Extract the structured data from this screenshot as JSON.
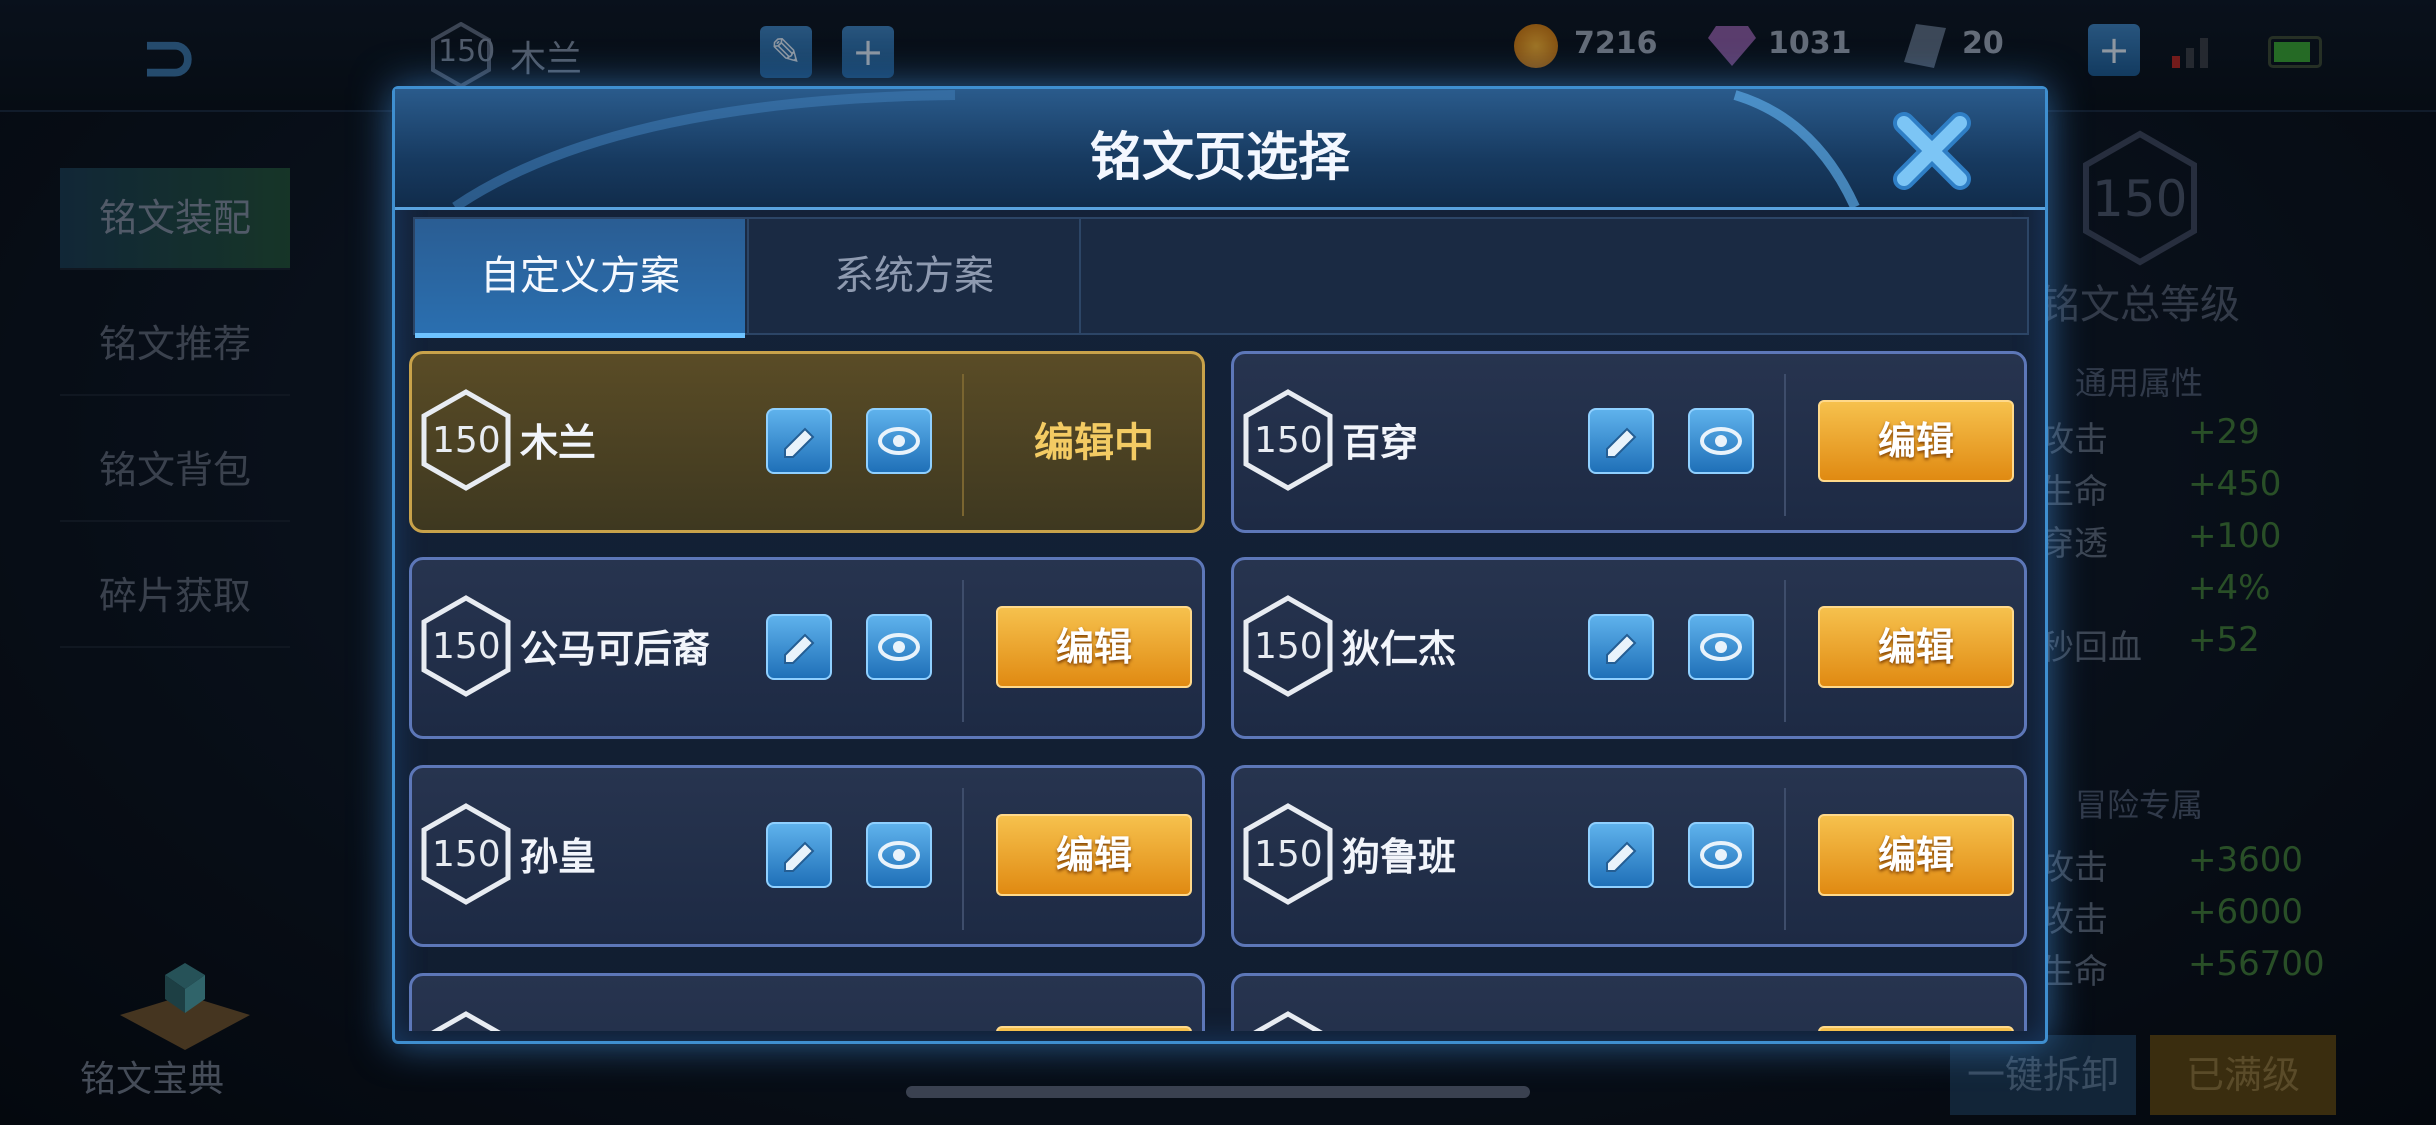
{
  "background": {
    "header": {
      "scheme_level": "150",
      "scheme_name": "木兰",
      "resources": [
        {
          "icon": "gold-coin-icon",
          "value": "7216"
        },
        {
          "icon": "diamond-icon",
          "value": "1031"
        },
        {
          "icon": "inscription-fragment-icon",
          "value": "20"
        }
      ]
    },
    "left_nav": {
      "items": [
        {
          "label": "铭文装配"
        },
        {
          "label": "铭文推荐"
        },
        {
          "label": "铭文背包"
        },
        {
          "label": "碎片获取"
        }
      ],
      "book_label": "铭文宝典"
    },
    "right_panel": {
      "total_level": "150",
      "total_level_label": "铭文总等级",
      "general_title": "通用属性",
      "general_stats": [
        {
          "name": "攻击",
          "value": "+29"
        },
        {
          "name": "生命",
          "value": "+450"
        },
        {
          "name": "穿透",
          "value": "+100"
        },
        {
          "name": "",
          "value": "+4%"
        },
        {
          "name": "秒回血",
          "value": "+52"
        }
      ],
      "adventure_title": "冒险专属",
      "adventure_stats": [
        {
          "name": "攻击",
          "value": "+3600"
        },
        {
          "name": "攻击",
          "value": "+6000"
        },
        {
          "name": "生命",
          "value": "+56700"
        }
      ],
      "dismantle_label": "一键拆卸",
      "maxed_label": "已满级"
    }
  },
  "dialog": {
    "title": "铭文页选择",
    "tabs": [
      {
        "label": "自定义方案",
        "active": true
      },
      {
        "label": "系统方案",
        "active": false
      }
    ],
    "pages": [
      {
        "level": "150",
        "name": "木兰",
        "status": "编辑中",
        "active": true
      },
      {
        "level": "150",
        "name": "百穿",
        "action": "编辑"
      },
      {
        "level": "150",
        "name": "公马可后裔",
        "action": "编辑"
      },
      {
        "level": "150",
        "name": "狄仁杰",
        "action": "编辑"
      },
      {
        "level": "150",
        "name": "孙皇",
        "action": "编辑"
      },
      {
        "level": "150",
        "name": "狗鲁班",
        "action": "编辑"
      }
    ]
  },
  "colors": {
    "accent_blue": "#3f8fd0",
    "edit_orange": "#e08a12",
    "active_gold": "#c8a24a",
    "stat_green": "#3f7a3c"
  }
}
